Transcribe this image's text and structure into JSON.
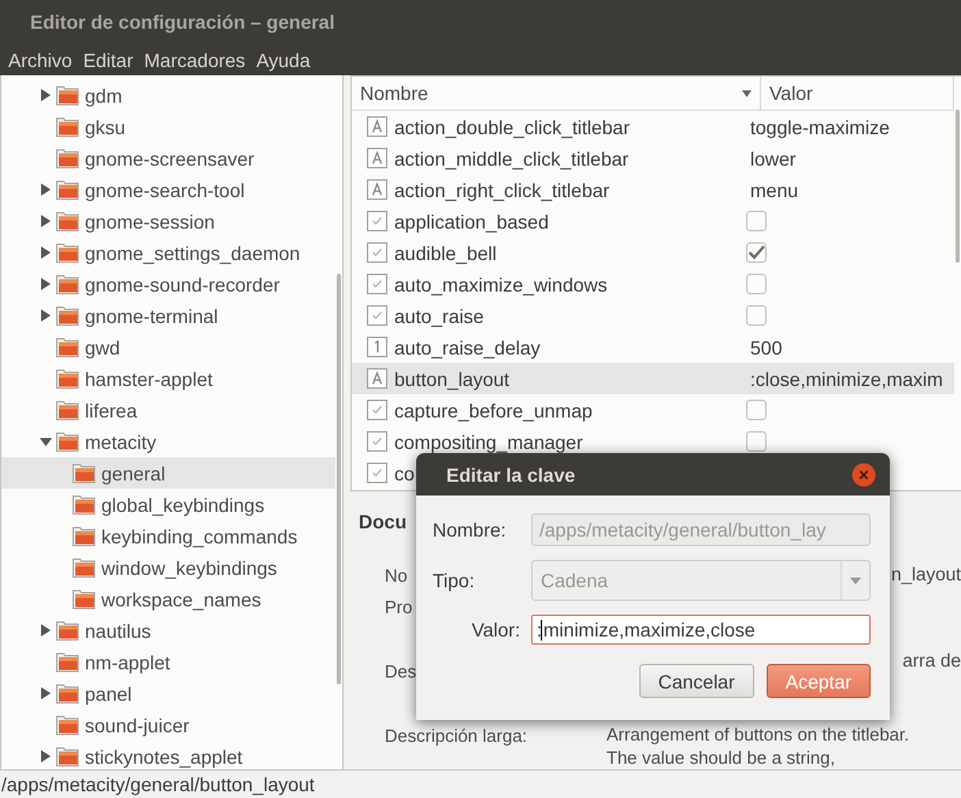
{
  "window": {
    "title": "Editor de configuración – general"
  },
  "menu": [
    "Archivo",
    "Editar",
    "Marcadores",
    "Ayuda"
  ],
  "tree": [
    {
      "name": "gdm",
      "expanded": false,
      "selected": false
    },
    {
      "name": "gksu",
      "selected": false
    },
    {
      "name": "gnome-screensaver",
      "selected": false
    },
    {
      "name": "gnome-search-tool",
      "expanded": false,
      "selected": false
    },
    {
      "name": "gnome-session",
      "expanded": false,
      "selected": false
    },
    {
      "name": "gnome_settings_daemon",
      "expanded": false,
      "selected": false
    },
    {
      "name": "gnome-sound-recorder",
      "expanded": false,
      "selected": false
    },
    {
      "name": "gnome-terminal",
      "expanded": false,
      "selected": false
    },
    {
      "name": "gwd",
      "selected": false
    },
    {
      "name": "hamster-applet",
      "selected": false
    },
    {
      "name": "liferea",
      "selected": false
    },
    {
      "name": "metacity",
      "expanded": true,
      "selected": false,
      "children": [
        {
          "name": "general",
          "selected": true
        },
        {
          "name": "global_keybindings",
          "selected": false
        },
        {
          "name": "keybinding_commands",
          "selected": false
        },
        {
          "name": "window_keybindings",
          "selected": false
        },
        {
          "name": "workspace_names",
          "selected": false
        }
      ]
    },
    {
      "name": "nautilus",
      "expanded": false,
      "selected": false
    },
    {
      "name": "nm-applet",
      "selected": false
    },
    {
      "name": "panel",
      "expanded": false,
      "selected": false
    },
    {
      "name": "sound-juicer",
      "selected": false
    },
    {
      "name": "stickynotes_applet",
      "expanded": false,
      "selected": false
    }
  ],
  "columns": [
    "Nombre",
    "Valor"
  ],
  "keys": [
    {
      "name": "action_double_click_titlebar",
      "kind": "string",
      "value": "toggle-maximize",
      "selected": false
    },
    {
      "name": "action_middle_click_titlebar",
      "kind": "string",
      "value": "lower",
      "selected": false
    },
    {
      "name": "action_right_click_titlebar",
      "kind": "string",
      "value": "menu",
      "selected": false
    },
    {
      "name": "application_based",
      "kind": "bool",
      "checked": false,
      "selected": false
    },
    {
      "name": "audible_bell",
      "kind": "bool",
      "checked": true,
      "selected": false
    },
    {
      "name": "auto_maximize_windows",
      "kind": "bool",
      "checked": false,
      "selected": false
    },
    {
      "name": "auto_raise",
      "kind": "bool",
      "checked": false,
      "selected": false
    },
    {
      "name": "auto_raise_delay",
      "kind": "int",
      "value": "500",
      "selected": false
    },
    {
      "name": "button_layout",
      "kind": "string",
      "value": ":close,minimize,maxim",
      "selected": true
    },
    {
      "name": "capture_before_unmap",
      "kind": "bool",
      "checked": false,
      "selected": false
    },
    {
      "name": "compositing_manager",
      "kind": "bool",
      "checked": false,
      "selected": false
    },
    {
      "name": "co",
      "kind": "bool",
      "selected": false
    }
  ],
  "documentation": {
    "heading": "Docu",
    "rows": [
      {
        "label": "No",
        "value": "n_layout",
        "kind": "partial"
      },
      {
        "label": "Pro",
        "kind": "partial"
      },
      {
        "label": "Des",
        "value": "arra de",
        "kind": "partial"
      },
      {
        "label": "Descripción larga:",
        "value": "Arrangement of buttons on the titlebar. The value should be a string,",
        "kind": "full"
      }
    ]
  },
  "dialog": {
    "title": "Editar la clave",
    "name_label": "Nombre:",
    "name_value": "/apps/metacity/general/button_lay",
    "type_label": "Tipo:",
    "type_value": "Cadena",
    "value_label": "Valor:",
    "value": ":minimize,maximize,close",
    "buttons": [
      {
        "label": "Cancelar",
        "kind": "secondary"
      },
      {
        "label": "Aceptar",
        "kind": "primary"
      }
    ]
  },
  "status_bar": "/apps/metacity/general/button_layout"
}
